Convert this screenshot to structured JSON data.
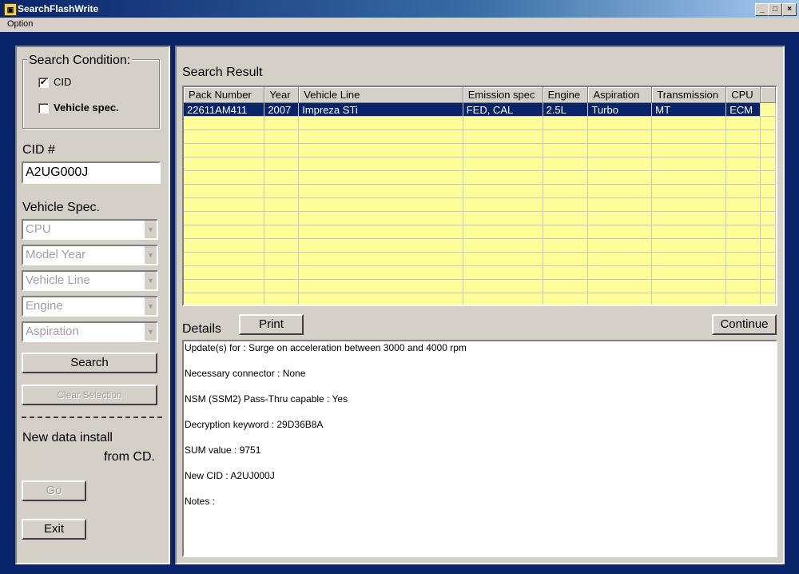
{
  "window": {
    "title": "SearchFlashWrite"
  },
  "menu": {
    "option": "Option"
  },
  "search_condition": {
    "title": "Search Condition:",
    "cid": {
      "label": "CID",
      "checked": true
    },
    "vehicle_spec": {
      "label": "Vehicle spec.",
      "checked": false
    }
  },
  "cid_field": {
    "label": "CID #",
    "value": "A2UG000J"
  },
  "vehicle_spec": {
    "title": "Vehicle Spec.",
    "dropdowns": [
      "CPU",
      "Model Year",
      "Vehicle Line",
      "Engine",
      "Aspiration"
    ]
  },
  "buttons": {
    "search": "Search",
    "clear_selection": "Clear Selection",
    "print": "Print",
    "continue": "Continue",
    "go": "Go",
    "exit": "Exit"
  },
  "install": {
    "line1": "New data install",
    "line2": "from CD."
  },
  "results": {
    "title": "Search Result",
    "columns": [
      "Pack Number",
      "Year",
      "Vehicle Line",
      "Emission spec",
      "Engine",
      "Aspiration",
      "Transmission",
      "CPU"
    ],
    "rows": [
      [
        "22611AM411",
        "2007",
        "Impreza STi",
        "FED, CAL",
        "2.5L",
        "Turbo",
        "MT",
        "ECM"
      ]
    ]
  },
  "details": {
    "title": "Details",
    "lines": [
      "Update(s) for : Surge on acceleration between 3000 and 4000 rpm",
      "Necessary connector : None",
      "NSM (SSM2) Pass-Thru capable : Yes",
      "Decryption keyword : 29D36B8A",
      "SUM value : 9751",
      "New CID : A2UJ000J",
      "Notes :"
    ]
  },
  "colors": {
    "frame": "#0a246a",
    "grid_bg": "#ffff99",
    "selection": "#0a246a",
    "face": "#d4d0c8"
  }
}
